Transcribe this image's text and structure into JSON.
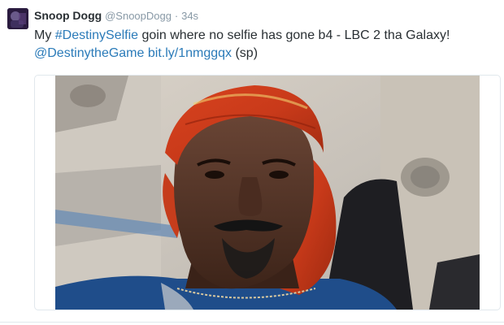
{
  "tweet": {
    "author_name": "Snoop Dogg",
    "author_handle": "@SnoopDogg",
    "separator": "·",
    "timestamp": "34s",
    "text_prefix": "My ",
    "hashtag": "#DestinySelfie",
    "text_main": " goin where no selfie has gone b4 - LBC 2 tha Galaxy!",
    "mention": "@DestinytheGame",
    "url": "bit.ly/1nmggqx",
    "text_suffix": " (sp)"
  },
  "colors": {
    "link": "#2b7bb9",
    "muted": "#8899a6",
    "text": "#292f33",
    "border": "#e1e8ed"
  }
}
